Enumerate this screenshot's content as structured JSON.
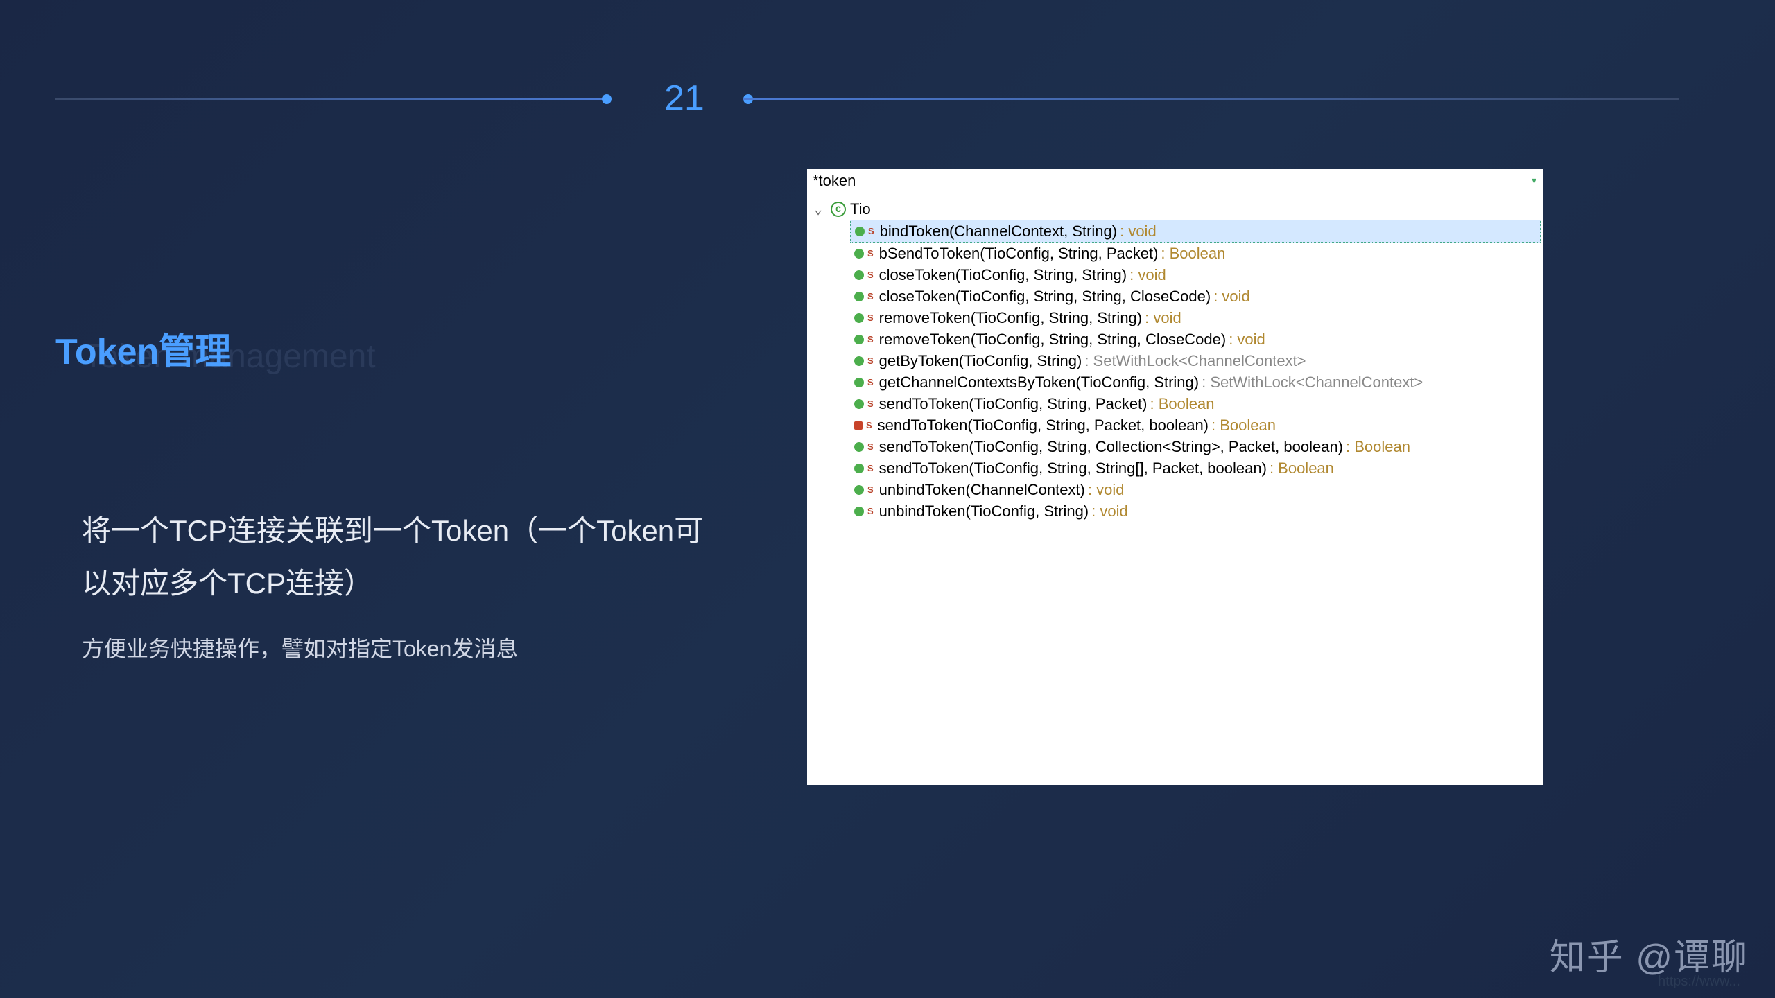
{
  "pageNumber": "21",
  "title": {
    "main": "Token管理",
    "shadow": "Token management"
  },
  "description": {
    "main": "将一个TCP连接关联到一个Token（一个Token可以对应多个TCP连接）",
    "sub": "方便业务快捷操作，譬如对指定Token发消息"
  },
  "codePanel": {
    "search": "*token",
    "className": "Tio",
    "methods": [
      {
        "icon": "green",
        "selected": true,
        "sig": "bindToken(ChannelContext, String)",
        "ret": ": void",
        "retClass": ""
      },
      {
        "icon": "green",
        "selected": false,
        "sig": "bSendToToken(TioConfig, String, Packet)",
        "ret": ": Boolean",
        "retClass": ""
      },
      {
        "icon": "green",
        "selected": false,
        "sig": "closeToken(TioConfig, String, String)",
        "ret": ": void",
        "retClass": ""
      },
      {
        "icon": "green",
        "selected": false,
        "sig": "closeToken(TioConfig, String, String, CloseCode)",
        "ret": ": void",
        "retClass": ""
      },
      {
        "icon": "green",
        "selected": false,
        "sig": "removeToken(TioConfig, String, String)",
        "ret": ": void",
        "retClass": ""
      },
      {
        "icon": "green",
        "selected": false,
        "sig": "removeToken(TioConfig, String, String, CloseCode)",
        "ret": ": void",
        "retClass": ""
      },
      {
        "icon": "green",
        "selected": false,
        "sig": "getByToken(TioConfig, String)",
        "ret": ": SetWithLock<ChannelContext>",
        "retClass": "generic"
      },
      {
        "icon": "green",
        "selected": false,
        "sig": "getChannelContextsByToken(TioConfig, String)",
        "ret": ": SetWithLock<ChannelContext>",
        "retClass": "generic"
      },
      {
        "icon": "green",
        "selected": false,
        "sig": "sendToToken(TioConfig, String, Packet)",
        "ret": ": Boolean",
        "retClass": ""
      },
      {
        "icon": "red",
        "selected": false,
        "sig": "sendToToken(TioConfig, String, Packet, boolean)",
        "ret": ": Boolean",
        "retClass": ""
      },
      {
        "icon": "green",
        "selected": false,
        "sig": "sendToToken(TioConfig, String, Collection<String>, Packet, boolean)",
        "ret": ": Boolean",
        "retClass": ""
      },
      {
        "icon": "green",
        "selected": false,
        "sig": "sendToToken(TioConfig, String, String[], Packet, boolean)",
        "ret": ": Boolean",
        "retClass": ""
      },
      {
        "icon": "green",
        "selected": false,
        "sig": "unbindToken(ChannelContext)",
        "ret": ": void",
        "retClass": ""
      },
      {
        "icon": "green",
        "selected": false,
        "sig": "unbindToken(TioConfig, String)",
        "ret": ": void",
        "retClass": ""
      }
    ]
  },
  "watermark": "知乎 @谭聊",
  "watermarkUrl": "https://www..."
}
